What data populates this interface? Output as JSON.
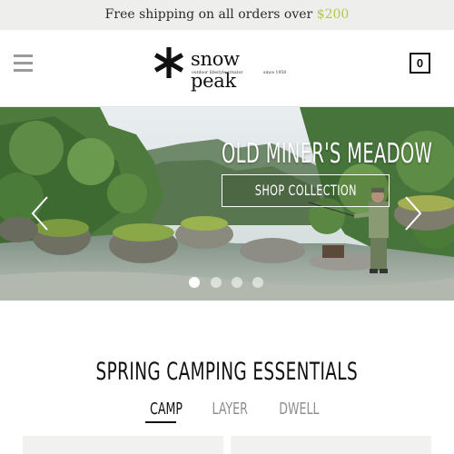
{
  "announcement": {
    "text": "Free shipping on all orders over ",
    "amount": "$200"
  },
  "header": {
    "menu_icon": "hamburger-menu-icon",
    "logo": {
      "icon": "asterisk-star-icon",
      "brand": "snow peak",
      "tagline": "outdoor lifestyle creator",
      "since": "since 1958"
    },
    "cart_count": "0",
    "cart_icon": "cart-box-icon"
  },
  "hero": {
    "title": "OLD MINER'S MEADOW",
    "cta_label": "SHOP COLLECTION",
    "prev_icon": "chevron-left-icon",
    "next_icon": "chevron-right-icon",
    "slide_count": 4,
    "active_slide": 1
  },
  "section": {
    "title": "SPRING CAMPING ESSENTIALS",
    "tabs": [
      {
        "label": "CAMP",
        "active": true
      },
      {
        "label": "LAYER",
        "active": false
      },
      {
        "label": "DWELL",
        "active": false
      }
    ]
  },
  "colors": {
    "accent": "#b1c94a",
    "announcement_bg": "#eeeeec",
    "text": "#111111",
    "tab_inactive": "#8e8e8e"
  }
}
